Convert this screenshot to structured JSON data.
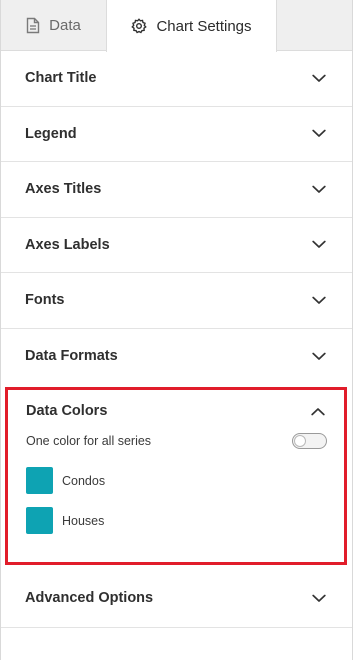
{
  "tabs": {
    "data_label": "Data",
    "settings_label": "Chart Settings"
  },
  "sections": [
    {
      "label": "Chart Title",
      "state": "collapsed"
    },
    {
      "label": "Legend",
      "state": "collapsed"
    },
    {
      "label": "Axes Titles",
      "state": "collapsed"
    },
    {
      "label": "Axes Labels",
      "state": "collapsed"
    },
    {
      "label": "Fonts",
      "state": "collapsed"
    },
    {
      "label": "Data Formats",
      "state": "collapsed"
    }
  ],
  "data_colors": {
    "label": "Data Colors",
    "state": "expanded",
    "toggle_label": "One color for all series",
    "toggle_on": false,
    "series": [
      {
        "name": "Condos",
        "color": "#0ea3b3"
      },
      {
        "name": "Houses",
        "color": "#0ea3b3"
      }
    ]
  },
  "advanced": {
    "label": "Advanced Options",
    "state": "collapsed"
  },
  "colors": {
    "highlight_border": "#e11d2a",
    "tab_inactive_bg": "#efefef"
  },
  "icons": {
    "data_tab": "document-icon",
    "settings_tab": "gear-icon",
    "collapse": "chevron-down-icon",
    "expand": "chevron-up-icon"
  }
}
